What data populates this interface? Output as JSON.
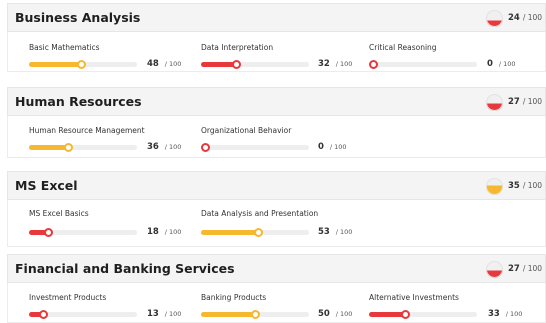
{
  "colors": {
    "red": "#e8383b",
    "orange": "#f5b82e",
    "track": "#eeeeee"
  },
  "sections": [
    {
      "title": "Business Analysis",
      "score": "24",
      "max": "/ 100",
      "score_fraction": 0.24,
      "color": "#e8383b",
      "topics": [
        {
          "name": "Basic Mathematics",
          "score": "48",
          "max": "/ 100",
          "fraction": 0.48,
          "color": "#f5b82e"
        },
        {
          "name": "Data Interpretation",
          "score": "32",
          "max": "/ 100",
          "fraction": 0.32,
          "color": "#e8383b"
        },
        {
          "name": "Critical Reasoning",
          "score": "0",
          "max": "/ 100",
          "fraction": 0.0,
          "color": "#e8383b"
        }
      ]
    },
    {
      "title": "Human Resources",
      "score": "27",
      "max": "/ 100",
      "score_fraction": 0.27,
      "color": "#e8383b",
      "topics": [
        {
          "name": "Human Resource Management",
          "score": "36",
          "max": "/ 100",
          "fraction": 0.36,
          "color": "#f5b82e"
        },
        {
          "name": "Organizational Behavior",
          "score": "0",
          "max": "/ 100",
          "fraction": 0.0,
          "color": "#e8383b"
        }
      ]
    },
    {
      "title": "MS Excel",
      "score": "35",
      "max": "/ 100",
      "score_fraction": 0.35,
      "color": "#f5b82e",
      "topics": [
        {
          "name": "MS Excel Basics",
          "score": "18",
          "max": "/ 100",
          "fraction": 0.18,
          "color": "#e8383b"
        },
        {
          "name": "Data Analysis and Presentation",
          "score": "53",
          "max": "/ 100",
          "fraction": 0.53,
          "color": "#f5b82e"
        }
      ]
    },
    {
      "title": "Financial and Banking Services",
      "score": "27",
      "max": "/ 100",
      "score_fraction": 0.27,
      "color": "#e8383b",
      "topics": [
        {
          "name": "Investment Products",
          "score": "13",
          "max": "/ 100",
          "fraction": 0.13,
          "color": "#e8383b"
        },
        {
          "name": "Banking Products",
          "score": "50",
          "max": "/ 100",
          "fraction": 0.5,
          "color": "#f5b82e"
        },
        {
          "name": "Alternative Investments",
          "score": "33",
          "max": "/ 100",
          "fraction": 0.33,
          "color": "#e8383b"
        }
      ]
    }
  ]
}
